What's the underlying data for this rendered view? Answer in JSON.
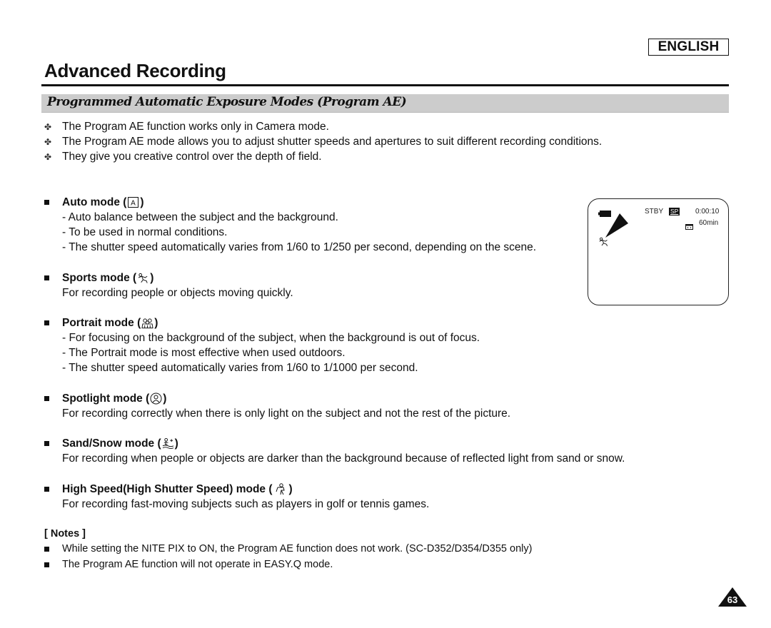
{
  "header": {
    "language": "ENGLISH",
    "title": "Advanced Recording",
    "section_title": "Programmed Automatic Exposure Modes (Program AE)"
  },
  "intro": [
    "The Program AE function works only in Camera mode.",
    "The Program AE mode allows you to adjust shutter speeds and apertures to suit different recording conditions.",
    "They give you creative control over the depth of field."
  ],
  "modes": [
    {
      "label": "Auto mode (",
      "close": ")",
      "icon": "auto-A-icon",
      "lines": [
        "- Auto balance between the subject and the background.",
        "- To be used in normal conditions.",
        "- The shutter speed automatically varies from 1/60 to 1/250 per second, depending on the scene."
      ]
    },
    {
      "label": "Sports mode (",
      "close": ")",
      "icon": "running-person-icon",
      "lines": [
        "For recording people or objects moving quickly."
      ]
    },
    {
      "label": "Portrait mode (",
      "close": ")",
      "icon": "portrait-people-icon",
      "lines": [
        "- For focusing on the background of the subject, when the background is out of focus.",
        "- The Portrait mode is most effective when used outdoors.",
        "- The shutter speed automatically varies from 1/60 to 1/1000 per second."
      ]
    },
    {
      "label": "Spotlight mode (",
      "close": ")",
      "icon": "spotlight-person-icon",
      "lines": [
        "For recording correctly when there is only light on the subject and not the rest of the picture."
      ]
    },
    {
      "label": "Sand/Snow mode (",
      "close": ")",
      "icon": "sand-snow-icon",
      "lines": [
        "For recording when people or objects are darker than the background because of reflected light from sand or snow."
      ]
    },
    {
      "label": "High Speed(High Shutter Speed) mode (",
      "close": ")",
      "icon": "high-speed-golfer-icon",
      "lines": [
        "For recording fast-moving subjects such as players in golf or tennis games."
      ]
    }
  ],
  "notes": {
    "title": "[ Notes ]",
    "items": [
      "While setting the NITE PIX to ON, the Program AE function does not work. (SC-D352/D354/D355 only)",
      "The Program AE function will not operate in EASY.Q mode."
    ]
  },
  "lcd": {
    "status": "STBY",
    "tape_speed": "SP",
    "timecode": "0:00:10",
    "remaining": "60min",
    "battery_icon": "battery-icon",
    "mode_icon": "running-person-icon"
  },
  "page_number": "63"
}
